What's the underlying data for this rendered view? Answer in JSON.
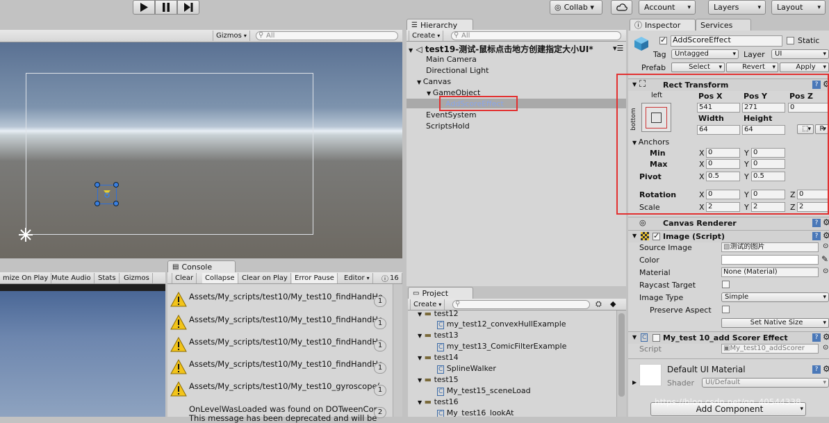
{
  "toolbar": {
    "play_icon": "play-icon",
    "pause_icon": "pause-icon",
    "step_icon": "step-icon",
    "collab": "Collab ▾",
    "cloud_icon": "cloud-icon",
    "account": "Account",
    "layers": "Layers",
    "layout": "Layout"
  },
  "scene": {
    "gizmos": "Gizmos",
    "search_placeholder": "All"
  },
  "game": {
    "buttons": [
      "mize On Play",
      "Mute Audio",
      "Stats",
      "Gizmos"
    ]
  },
  "console": {
    "tab": "Console",
    "buttons": [
      "Clear",
      "Collapse",
      "Clear on Play",
      "Error Pause",
      "Editor"
    ],
    "error_count": "16",
    "messages": [
      {
        "text": "Assets/My_scripts/test10/My_test10_findHandHe",
        "count": "1"
      },
      {
        "text": "Assets/My_scripts/test10/My_test10_findHandHe",
        "count": "1"
      },
      {
        "text": "Assets/My_scripts/test10/My_test10_findHandHe",
        "count": "1"
      },
      {
        "text": "Assets/My_scripts/test10/My_test10_findHandHe",
        "count": "1"
      },
      {
        "text": "Assets/My_scripts/test10/My_test10_gyroscope(",
        "count": "1"
      }
    ],
    "last_message_line1": "OnLevelWasLoaded was found on DOTweenCom",
    "last_message_line2": "This message has been deprecated and will be",
    "last_count": "2"
  },
  "hierarchy": {
    "tab": "Hierarchy",
    "create": "Create",
    "search_placeholder": "All",
    "scene_name": "test19-测试-鼠标点击地方创建指定大小UI*",
    "items": [
      {
        "label": "Main Camera"
      },
      {
        "label": "Directional Light"
      },
      {
        "label": "Canvas"
      },
      {
        "label": "GameObject"
      },
      {
        "label": "AddScoreEffect"
      },
      {
        "label": "EventSystem"
      },
      {
        "label": "ScriptsHold"
      }
    ]
  },
  "project": {
    "tab": "Project",
    "create": "Create",
    "items": [
      {
        "label": "test12",
        "type": "folder"
      },
      {
        "label": "my_test12_convexHullExample",
        "type": "script"
      },
      {
        "label": "test13",
        "type": "folder"
      },
      {
        "label": "my_test13_ComicFilterExample",
        "type": "script"
      },
      {
        "label": "test14",
        "type": "folder"
      },
      {
        "label": "SplineWalker",
        "type": "script"
      },
      {
        "label": "test15",
        "type": "folder"
      },
      {
        "label": "My_test15_sceneLoad",
        "type": "script"
      },
      {
        "label": "test16",
        "type": "folder"
      },
      {
        "label": "My_test16_lookAt",
        "type": "script"
      }
    ]
  },
  "inspector": {
    "tab": "Inspector",
    "services_tab": "Services",
    "object_name": "AddScoreEffect",
    "static_label": "Static",
    "tag_label": "Tag",
    "tag_value": "Untagged",
    "layer_label": "Layer",
    "layer_value": "UI",
    "prefab_label": "Prefab",
    "prefab_select": "Select",
    "prefab_revert": "Revert",
    "prefab_apply": "Apply",
    "rect_transform": {
      "title": "Rect Transform",
      "anchor_left": "left",
      "anchor_bottom": "bottom",
      "pos_x_label": "Pos X",
      "pos_x": "541",
      "pos_y_label": "Pos Y",
      "pos_y": "271",
      "pos_z_label": "Pos Z",
      "pos_z": "0",
      "width_label": "Width",
      "width": "64",
      "height_label": "Height",
      "height": "64",
      "r_button": "R",
      "anchors_label": "Anchors",
      "min_label": "Min",
      "min_x": "0",
      "min_y": "0",
      "max_label": "Max",
      "max_x": "0",
      "max_y": "0",
      "pivot_label": "Pivot",
      "pivot_x": "0.5",
      "pivot_y": "0.5",
      "rotation_label": "Rotation",
      "rot_x": "0",
      "rot_y": "0",
      "rot_z": "0",
      "scale_label": "Scale",
      "scale_x": "2",
      "scale_y": "2",
      "scale_z": "2",
      "x": "X",
      "y": "Y",
      "z": "Z"
    },
    "canvas_renderer": "Canvas Renderer",
    "image": {
      "title": "Image (Script)",
      "source_image_label": "Source Image",
      "source_image": "测试的图片",
      "color_label": "Color",
      "material_label": "Material",
      "material": "None (Material)",
      "raycast_label": "Raycast Target",
      "image_type_label": "Image Type",
      "image_type": "Simple",
      "preserve_label": "Preserve Aspect",
      "set_native": "Set Native Size"
    },
    "script_comp": {
      "title": "My_test 10_add Scorer Effect",
      "script_label": "Script",
      "script_value": "My_test10_addScorer"
    },
    "material_section": {
      "title": "Default UI Material",
      "shader_label": "Shader",
      "shader_value": "UI/Default"
    },
    "add_component": "Add Component",
    "watermark": "https://blog.csdn.net/qq_40544338"
  },
  "colors": {
    "highlight_box": "#e23030",
    "selected_text": "#8aa6e8"
  }
}
